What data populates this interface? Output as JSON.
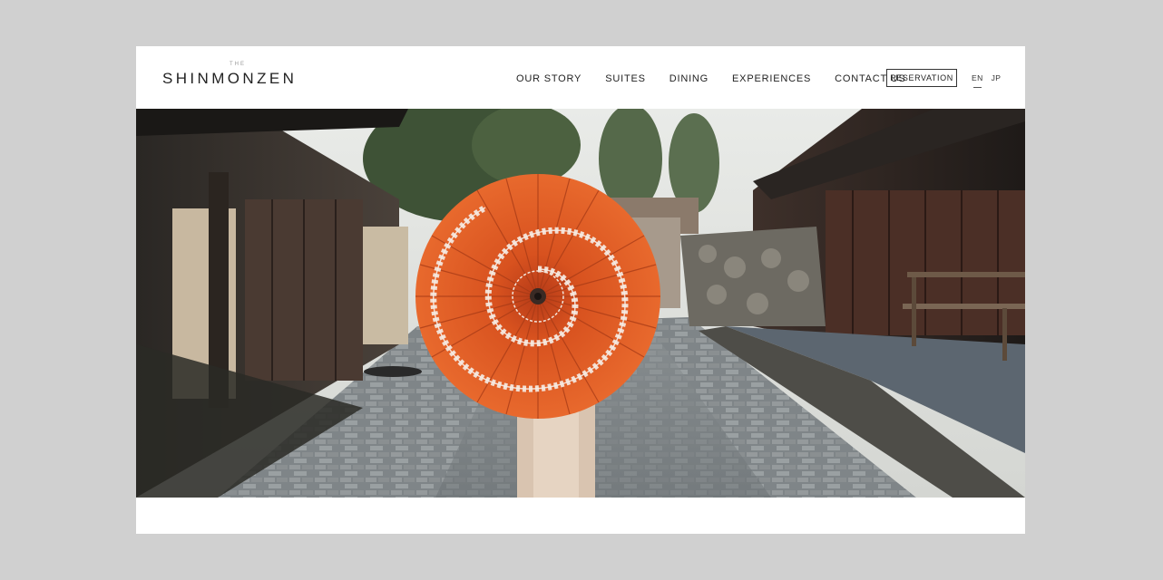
{
  "brand": {
    "prefix": "THE",
    "name": "SHINMONZEN"
  },
  "nav": {
    "items": [
      {
        "label": "OUR STORY"
      },
      {
        "label": "SUITES"
      },
      {
        "label": "DINING"
      },
      {
        "label": "EXPERIENCES"
      },
      {
        "label": "CONTACT US"
      }
    ],
    "reservation_label": "RESERVATION"
  },
  "languages": {
    "items": [
      "EN",
      "JP"
    ],
    "active": "EN"
  },
  "colors": {
    "umbrella": "#e0602a",
    "umbrella_dark": "#b3401a",
    "text": "#222222",
    "page_bg": "#ffffff",
    "outer_bg": "#d0d0d0"
  }
}
